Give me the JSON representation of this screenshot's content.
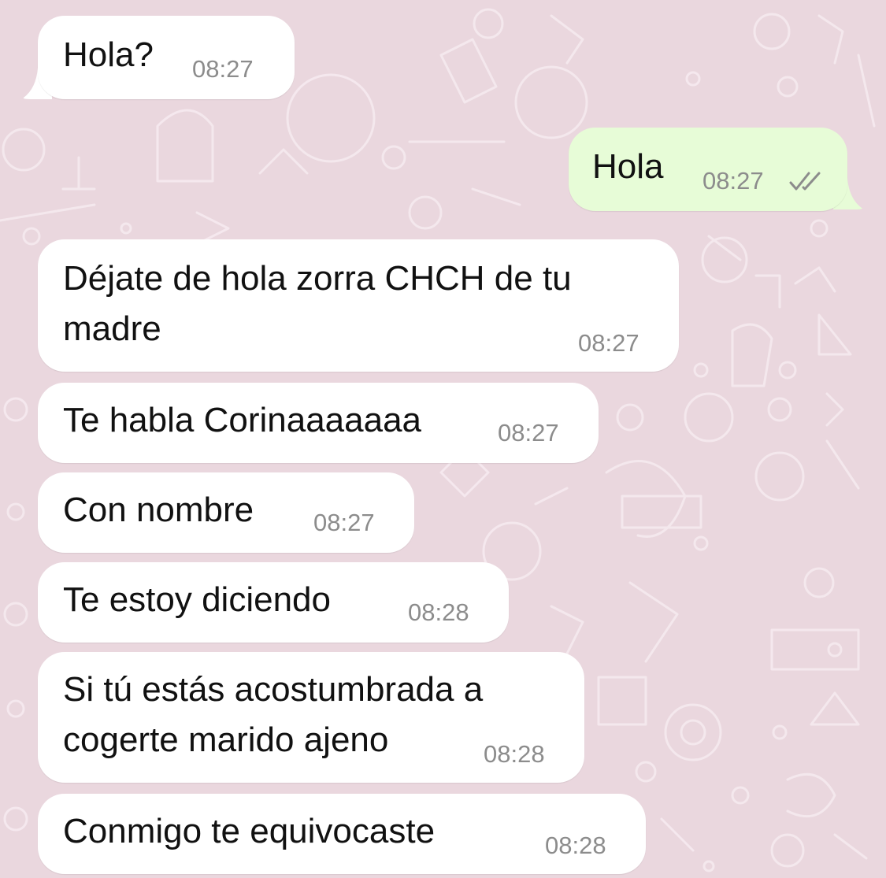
{
  "colors": {
    "wallpaper": "#ead7de",
    "incoming_bubble": "#ffffff",
    "outgoing_bubble": "#e7fcd7",
    "text": "#111111",
    "timestamp": "#8c8c8c",
    "read_ticks": "#8c8c8c"
  },
  "messages": [
    {
      "direction": "incoming",
      "text": "Hola?",
      "time": "08:27"
    },
    {
      "direction": "outgoing",
      "text": "Hola",
      "time": "08:27",
      "status_icon": "double-check-icon"
    },
    {
      "direction": "incoming",
      "lines": [
        "Déjate de hola zorra CHCH de tu",
        "madre"
      ],
      "time": "08:27"
    },
    {
      "direction": "incoming",
      "text": "Te habla Corinaaaaaaa",
      "time": "08:27"
    },
    {
      "direction": "incoming",
      "text": "Con nombre",
      "time": "08:27"
    },
    {
      "direction": "incoming",
      "text": "Te estoy diciendo",
      "time": "08:28"
    },
    {
      "direction": "incoming",
      "lines": [
        "Si tú estás acostumbrada a",
        "cogerte marido ajeno"
      ],
      "time": "08:28"
    },
    {
      "direction": "incoming",
      "text": "Conmigo te equivocaste",
      "time": "08:28"
    }
  ]
}
